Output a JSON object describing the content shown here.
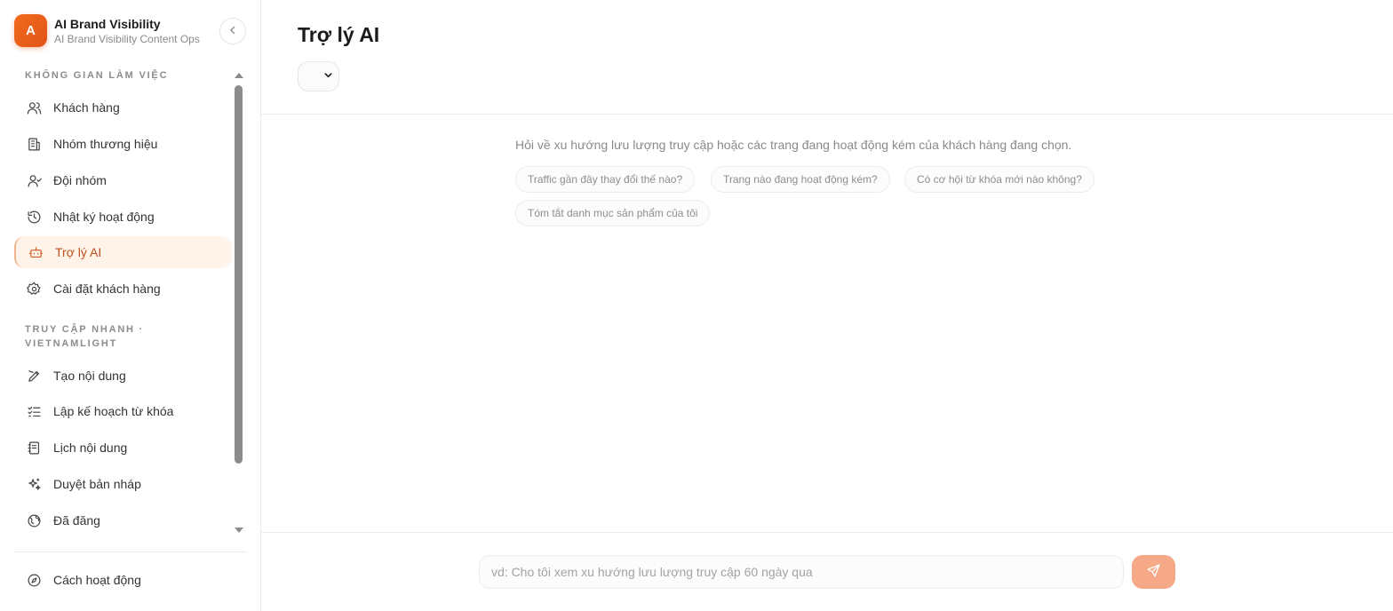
{
  "brand": {
    "logo_letter": "A",
    "title": "AI Brand Visibility",
    "subtitle": "AI Brand Visibility Content Ops"
  },
  "sidebar": {
    "workspace_label": "KHÔNG GIAN LÀM VIỆC",
    "workspace_items": [
      {
        "label": "Khách hàng",
        "icon": "users-icon"
      },
      {
        "label": "Nhóm thương hiệu",
        "icon": "building-icon"
      },
      {
        "label": "Đội nhóm",
        "icon": "user-group-icon"
      },
      {
        "label": "Nhật ký hoạt động",
        "icon": "history-icon"
      },
      {
        "label": "Trợ lý AI",
        "icon": "bot-icon",
        "active": true
      },
      {
        "label": "Cài đặt khách hàng",
        "icon": "gear-icon"
      }
    ],
    "quick_access_label_line1": "TRUY CẬP NHANH ·",
    "quick_access_label_line2": "VIETNAMLIGHT",
    "quick_items": [
      {
        "label": "Tạo nội dung",
        "icon": "pen-icon"
      },
      {
        "label": "Lập kế hoạch từ khóa",
        "icon": "checklist-icon"
      },
      {
        "label": "Lịch nội dung",
        "icon": "notebook-icon"
      },
      {
        "label": "Duyệt bản nháp",
        "icon": "sparkles-icon"
      },
      {
        "label": "Đã đăng",
        "icon": "globe-icon"
      }
    ],
    "footer_item": {
      "label": "Cách hoạt động",
      "icon": "compass-icon"
    }
  },
  "main": {
    "title": "Trợ lý AI",
    "hint": "Hỏi về xu hướng lưu lượng truy cập hoặc các trang đang hoạt động kém của khách hàng đang chọn.",
    "suggestions": [
      "Traffic gần đây thay đổi thế nào?",
      "Trang nào đang hoạt động kém?",
      "Có cơ hội từ khóa mới nào không?",
      "Tóm tắt danh mục sản phẩm của tôi"
    ],
    "input_placeholder": "vd: Cho tôi xem xu hướng lưu lượng truy cập 60 ngày qua"
  },
  "colors": {
    "accent": "#e8601c",
    "active_bg": "#fff3ea",
    "send_button": "#f6a987"
  }
}
